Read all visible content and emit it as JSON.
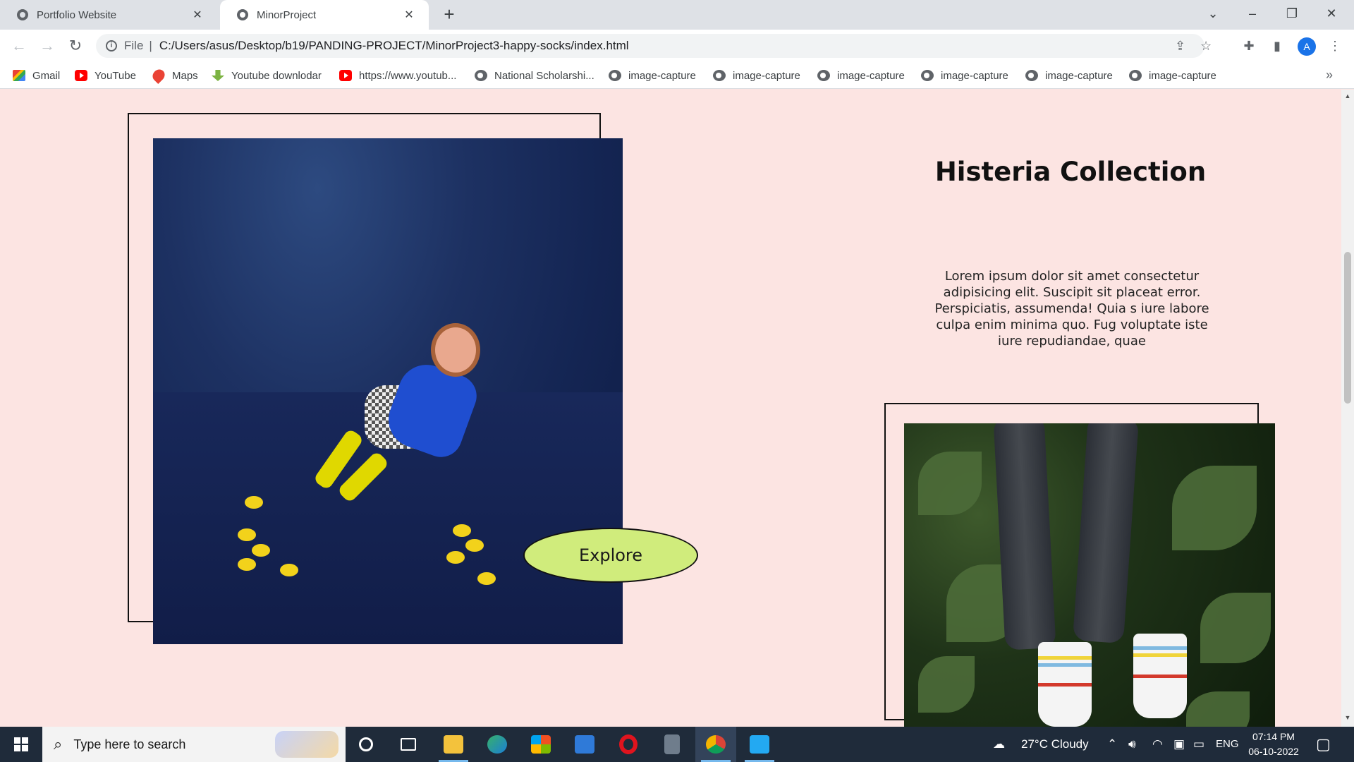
{
  "browser": {
    "tabs": [
      {
        "title": "Portfolio Website",
        "active": false
      },
      {
        "title": "MinorProject",
        "active": true
      }
    ],
    "new_tab_glyph": "+",
    "window_controls": {
      "tabsearch": "⌄",
      "minimize": "–",
      "restore": "❐",
      "close": "✕"
    },
    "address": {
      "scheme_label": "File",
      "separator": "|",
      "url": "C:/Users/asus/Desktop/b19/PANDING-PROJECT/MinorProject3-happy-socks/index.html"
    },
    "profile_initial": "A",
    "bookmarks": [
      {
        "label": "Gmail",
        "icon": "gmail-icon"
      },
      {
        "label": "YouTube",
        "icon": "youtube-icon"
      },
      {
        "label": "Maps",
        "icon": "maps-icon"
      },
      {
        "label": "Youtube downlodar",
        "icon": "download-icon"
      },
      {
        "label": "https://www.youtub...",
        "icon": "youtube-icon"
      },
      {
        "label": "National Scholarshi...",
        "icon": "globe-icon"
      },
      {
        "label": "image-capture",
        "icon": "globe-icon"
      },
      {
        "label": "image-capture",
        "icon": "globe-icon"
      },
      {
        "label": "image-capture",
        "icon": "globe-icon"
      },
      {
        "label": "image-capture",
        "icon": "globe-icon"
      },
      {
        "label": "image-capture",
        "icon": "globe-icon"
      },
      {
        "label": "image-capture",
        "icon": "globe-icon"
      }
    ],
    "bookmarks_overflow": "»"
  },
  "page": {
    "background_color": "#fce4e2",
    "explore_label": "Explore",
    "explore_color": "#d0ec7c",
    "collection_title": "Histeria Collection",
    "collection_description": "Lorem ipsum dolor sit amet consectetur adipisicing elit. Suscipit sit placeat error. Perspiciatis, assumenda! Quia s iure labore culpa enim minima quo. Fug voluptate iste iure repudiandae, quae"
  },
  "taskbar": {
    "search_placeholder": "Type here to search",
    "weather": "27°C Cloudy",
    "language": "ENG",
    "time": "07:14 PM",
    "date": "06-10-2022"
  }
}
